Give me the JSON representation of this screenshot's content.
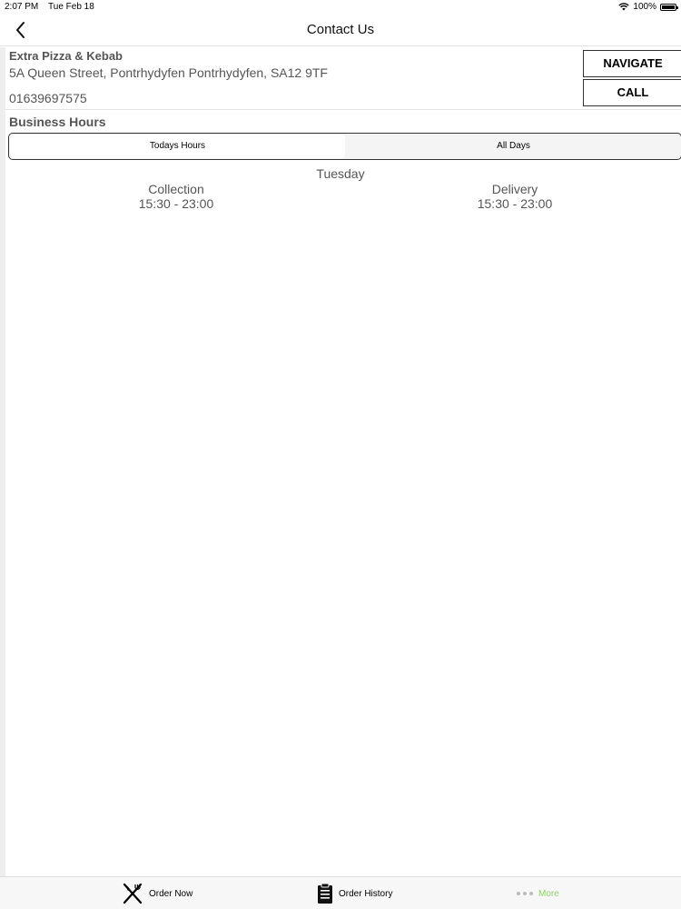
{
  "status_bar": {
    "time": "2:07 PM",
    "date": "Tue Feb 18",
    "battery": "100%",
    "battery_level": 1.0
  },
  "nav": {
    "title": "Contact Us",
    "back_icon": "chevron-left-icon"
  },
  "restaurant": {
    "name": "Extra Pizza & Kebab",
    "address": "5A Queen Street, Pontrhydyfen Pontrhydyfen, SA12 9TF",
    "phone": "01639697575"
  },
  "actions": {
    "navigate_label": "NAVIGATE",
    "call_label": "CALL"
  },
  "business_hours": {
    "title": "Business Hours",
    "tabs": [
      {
        "label": "Todays Hours",
        "active": true
      },
      {
        "label": "All Days",
        "active": false
      }
    ],
    "day": "Tuesday",
    "collection": {
      "label": "Collection",
      "hours": "15:30 - 23:00"
    },
    "delivery": {
      "label": "Delivery",
      "hours": "15:30 - 23:00"
    }
  },
  "tab_bar": {
    "items": [
      {
        "label": "Order Now",
        "icon": "fork-knife-icon"
      },
      {
        "label": "Order History",
        "icon": "clipboard-icon"
      },
      {
        "label": "More",
        "icon": "more-dots-icon",
        "active": true
      }
    ],
    "active_color": "#8fd36a"
  }
}
